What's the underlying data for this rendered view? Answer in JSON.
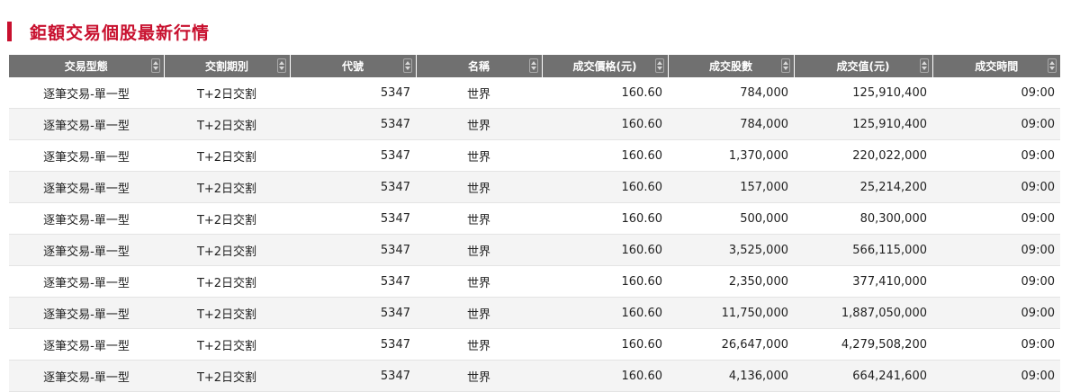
{
  "page": {
    "title": "鉅額交易個股最新行情"
  },
  "table": {
    "headers": [
      "交易型態",
      "交割期別",
      "代號",
      "名稱",
      "成交價格(元)",
      "成交股數",
      "成交值(元)",
      "成交時間"
    ],
    "rows": [
      [
        "逐筆交易-單一型",
        "T+2日交割",
        "5347",
        "世界",
        "160.60",
        "784,000",
        "125,910,400",
        "09:00"
      ],
      [
        "逐筆交易-單一型",
        "T+2日交割",
        "5347",
        "世界",
        "160.60",
        "784,000",
        "125,910,400",
        "09:00"
      ],
      [
        "逐筆交易-單一型",
        "T+2日交割",
        "5347",
        "世界",
        "160.60",
        "1,370,000",
        "220,022,000",
        "09:00"
      ],
      [
        "逐筆交易-單一型",
        "T+2日交割",
        "5347",
        "世界",
        "160.60",
        "157,000",
        "25,214,200",
        "09:00"
      ],
      [
        "逐筆交易-單一型",
        "T+2日交割",
        "5347",
        "世界",
        "160.60",
        "500,000",
        "80,300,000",
        "09:00"
      ],
      [
        "逐筆交易-單一型",
        "T+2日交割",
        "5347",
        "世界",
        "160.60",
        "3,525,000",
        "566,115,000",
        "09:00"
      ],
      [
        "逐筆交易-單一型",
        "T+2日交割",
        "5347",
        "世界",
        "160.60",
        "2,350,000",
        "377,410,000",
        "09:00"
      ],
      [
        "逐筆交易-單一型",
        "T+2日交割",
        "5347",
        "世界",
        "160.60",
        "11,750,000",
        "1,887,050,000",
        "09:00"
      ],
      [
        "逐筆交易-單一型",
        "T+2日交割",
        "5347",
        "世界",
        "160.60",
        "26,647,000",
        "4,279,508,200",
        "09:00"
      ],
      [
        "逐筆交易-單一型",
        "T+2日交割",
        "5347",
        "世界",
        "160.60",
        "4,136,000",
        "664,241,600",
        "09:00"
      ]
    ]
  },
  "colors": {
    "accent": "#c8102e",
    "header_bg": "#707070",
    "row_alt_bg": "#f4f4f4"
  },
  "icons": {
    "sort": "sort-updown-icon",
    "title_marker": "red-bar-marker"
  }
}
